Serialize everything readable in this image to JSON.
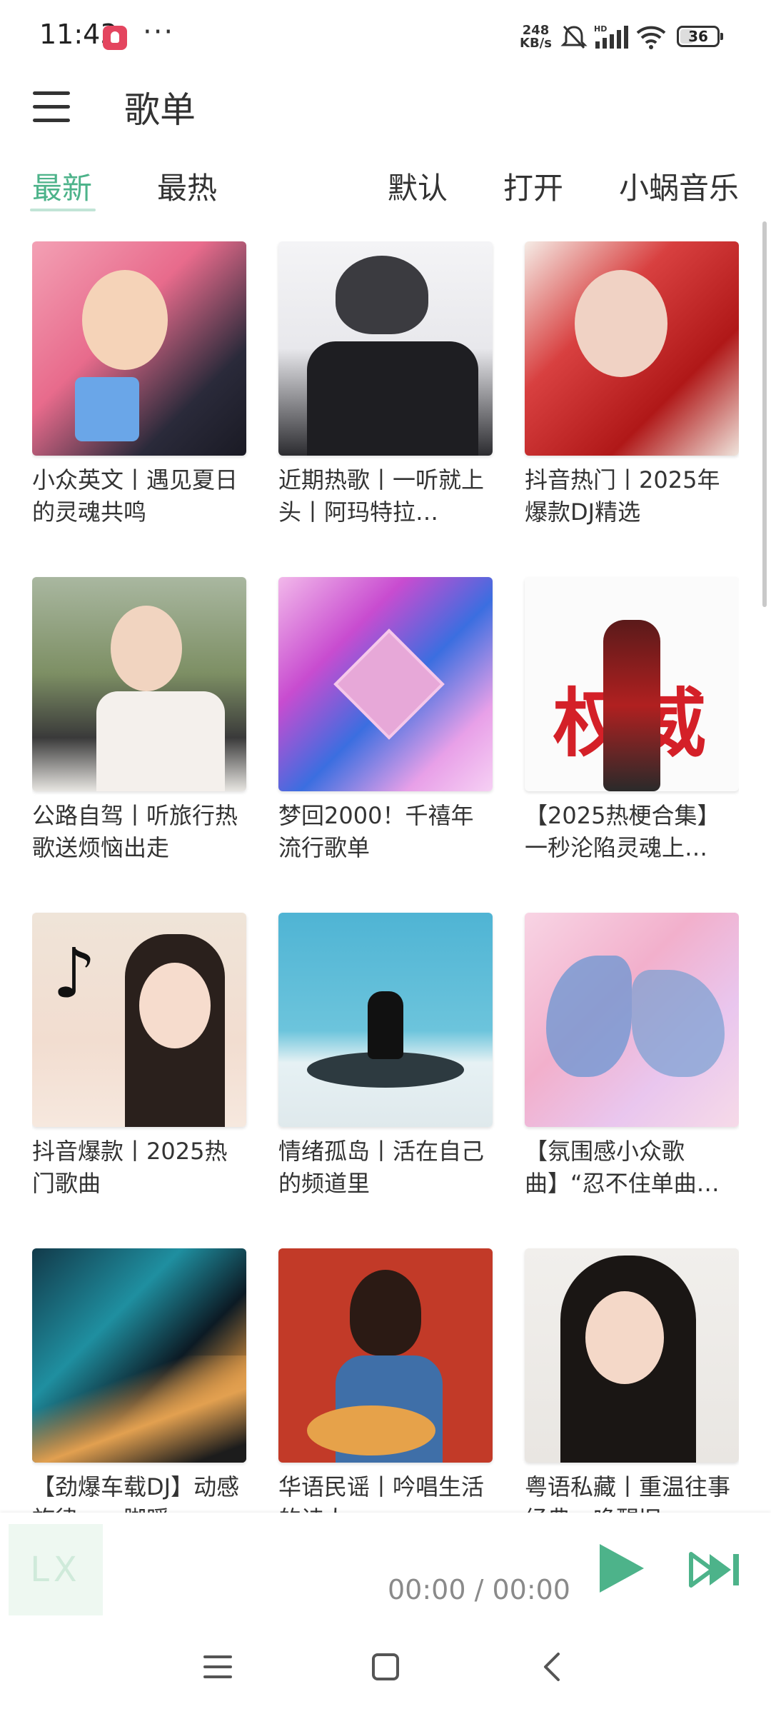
{
  "status_bar": {
    "time": "11:43",
    "more": "···",
    "speed_value": "248",
    "speed_unit": "KB/s",
    "network": "HD",
    "battery": "36",
    "battery_level": 0.36
  },
  "header": {
    "title": "歌单"
  },
  "tabs": [
    {
      "label": "最新",
      "active": true
    },
    {
      "label": "最热",
      "active": false
    },
    {
      "label": "默认",
      "active": false
    },
    {
      "label": "打开",
      "active": false
    },
    {
      "label": "小蜗音乐",
      "active": false
    }
  ],
  "playlists": [
    {
      "title": "小众英文丨遇见夏日的灵魂共鸣"
    },
    {
      "title": "近期热歌丨一听就上头丨阿玛特拉…"
    },
    {
      "title": "抖音热门丨2025年爆款DJ精选"
    },
    {
      "title": "公路自驾丨听旅行热歌送烦恼出走"
    },
    {
      "title": "梦回2000！千禧年流行歌单"
    },
    {
      "title": "【2025热梗合集】一秒沦陷灵魂上…",
      "cover_text": "权威"
    },
    {
      "title": "抖音爆款丨2025热门歌曲"
    },
    {
      "title": "情绪孤岛丨活在自己的频道里"
    },
    {
      "title": "【氛围感小众歌曲】“忍不住单曲…"
    },
    {
      "title": "【劲爆车载DJ】动感旋律一…脚暖…"
    },
    {
      "title": "华语民谣丨吟唱生活的诗人"
    },
    {
      "title": "粤语私藏丨重温往事经典…唤醒旧…"
    }
  ],
  "player": {
    "logo": "LX",
    "time": "00:00 / 00:00"
  },
  "colors": {
    "accent": "#4db38a",
    "play": "#4db38a"
  }
}
